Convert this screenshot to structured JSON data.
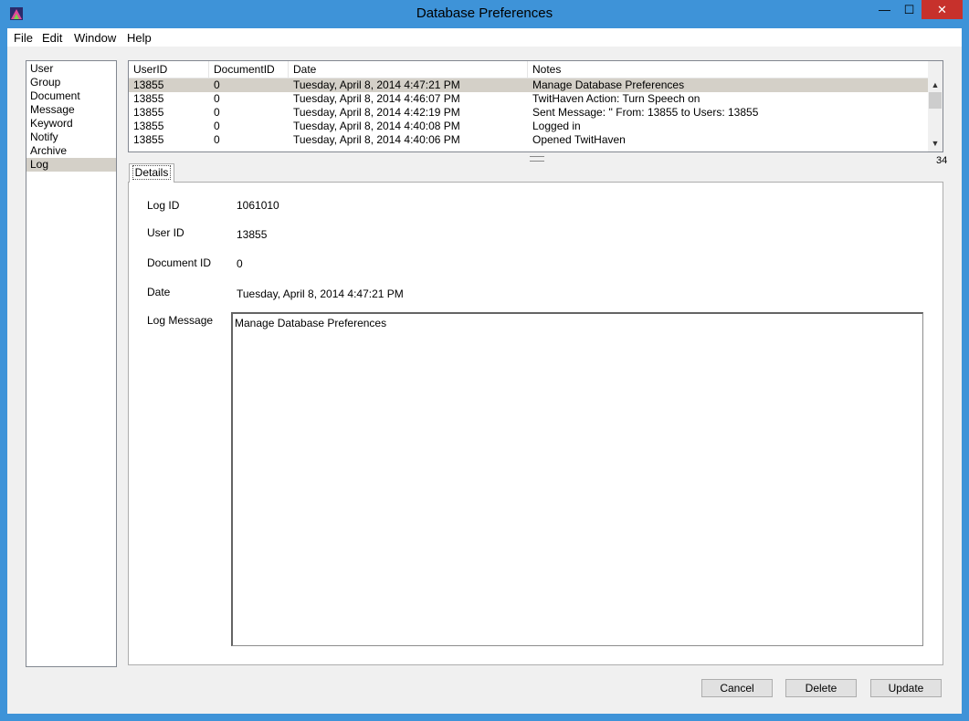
{
  "window": {
    "title": "Database Preferences",
    "minimize_glyph": "—",
    "maximize_glyph": "☐",
    "close_glyph": "✕"
  },
  "menu": {
    "file": "File",
    "edit": "Edit",
    "window": "Window",
    "help": "Help"
  },
  "sidebar": {
    "items": [
      {
        "label": "User",
        "selected": false
      },
      {
        "label": "Group",
        "selected": false
      },
      {
        "label": "Document",
        "selected": false
      },
      {
        "label": "Message",
        "selected": false
      },
      {
        "label": "Keyword",
        "selected": false
      },
      {
        "label": "Notify",
        "selected": false
      },
      {
        "label": "Archive",
        "selected": false
      },
      {
        "label": "Log",
        "selected": true
      }
    ]
  },
  "grid": {
    "columns": [
      "UserID",
      "DocumentID",
      "Date",
      "Notes"
    ],
    "rows": [
      {
        "userid": "13855",
        "documentid": "0",
        "date": "Tuesday, April 8, 2014 4:47:21 PM",
        "notes": "Manage Database Preferences",
        "selected": true
      },
      {
        "userid": "13855",
        "documentid": "0",
        "date": "Tuesday, April 8, 2014 4:46:07 PM",
        "notes": "TwitHaven Action: Turn Speech on",
        "selected": false
      },
      {
        "userid": "13855",
        "documentid": "0",
        "date": "Tuesday, April 8, 2014 4:42:19 PM",
        "notes": "Sent Message: '' From: 13855 to Users: 13855",
        "selected": false
      },
      {
        "userid": "13855",
        "documentid": "0",
        "date": "Tuesday, April 8, 2014 4:40:08 PM",
        "notes": "Logged in",
        "selected": false
      },
      {
        "userid": "13855",
        "documentid": "0",
        "date": "Tuesday, April 8, 2014 4:40:06 PM",
        "notes": "Opened TwitHaven",
        "selected": false
      }
    ],
    "up_arrow": "▲",
    "down_arrow": "▼"
  },
  "record_count": "34",
  "tab": {
    "label": "Details"
  },
  "details": {
    "log_id_label": "Log ID",
    "log_id_value": "1061010",
    "user_id_label": "User ID",
    "user_id_value": "13855",
    "document_id_label": "Document ID",
    "document_id_value": "0",
    "date_label": "Date",
    "date_value": "Tuesday, April 8, 2014 4:47:21 PM",
    "log_message_label": "Log Message",
    "log_message_value": "Manage Database Preferences"
  },
  "buttons": {
    "cancel": "Cancel",
    "delete": "Delete",
    "update": "Update"
  },
  "colors": {
    "titlebar": "#3e93d8",
    "close_button": "#c7312c",
    "selection": "#d4d0c8"
  }
}
